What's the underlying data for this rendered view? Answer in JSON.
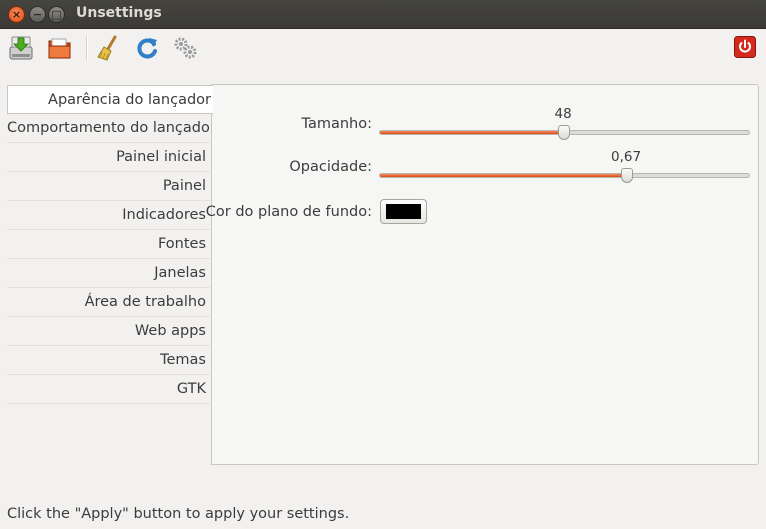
{
  "window": {
    "title": "Unsettings"
  },
  "toolbar": {
    "buttons": [
      {
        "name": "save-icon"
      },
      {
        "name": "open-folder-icon"
      },
      {
        "name": "broom-icon"
      },
      {
        "name": "refresh-icon"
      },
      {
        "name": "gears-icon"
      },
      {
        "name": "power-icon"
      }
    ]
  },
  "sidebar": {
    "items": [
      {
        "label": "Aparência do lançador"
      },
      {
        "label": "Comportamento do lançador"
      },
      {
        "label": "Painel inicial"
      },
      {
        "label": "Painel"
      },
      {
        "label": "Indicadores"
      },
      {
        "label": "Fontes"
      },
      {
        "label": "Janelas"
      },
      {
        "label": "Área de trabalho"
      },
      {
        "label": "Web apps"
      },
      {
        "label": "Temas"
      },
      {
        "label": "GTK"
      }
    ]
  },
  "main": {
    "size": {
      "label": "Tamanho:",
      "value_text": "48",
      "fraction": 0.497
    },
    "opacity": {
      "label": "Opacidade:",
      "value_text": "0,67",
      "fraction": 0.665
    },
    "background": {
      "label": "Cor do plano de fundo:",
      "color": "#000000"
    }
  },
  "status": {
    "text": "Click the \"Apply\" button to apply your settings."
  },
  "colors": {
    "accent": "#df4a16",
    "titlebar": "#3c3b37"
  }
}
